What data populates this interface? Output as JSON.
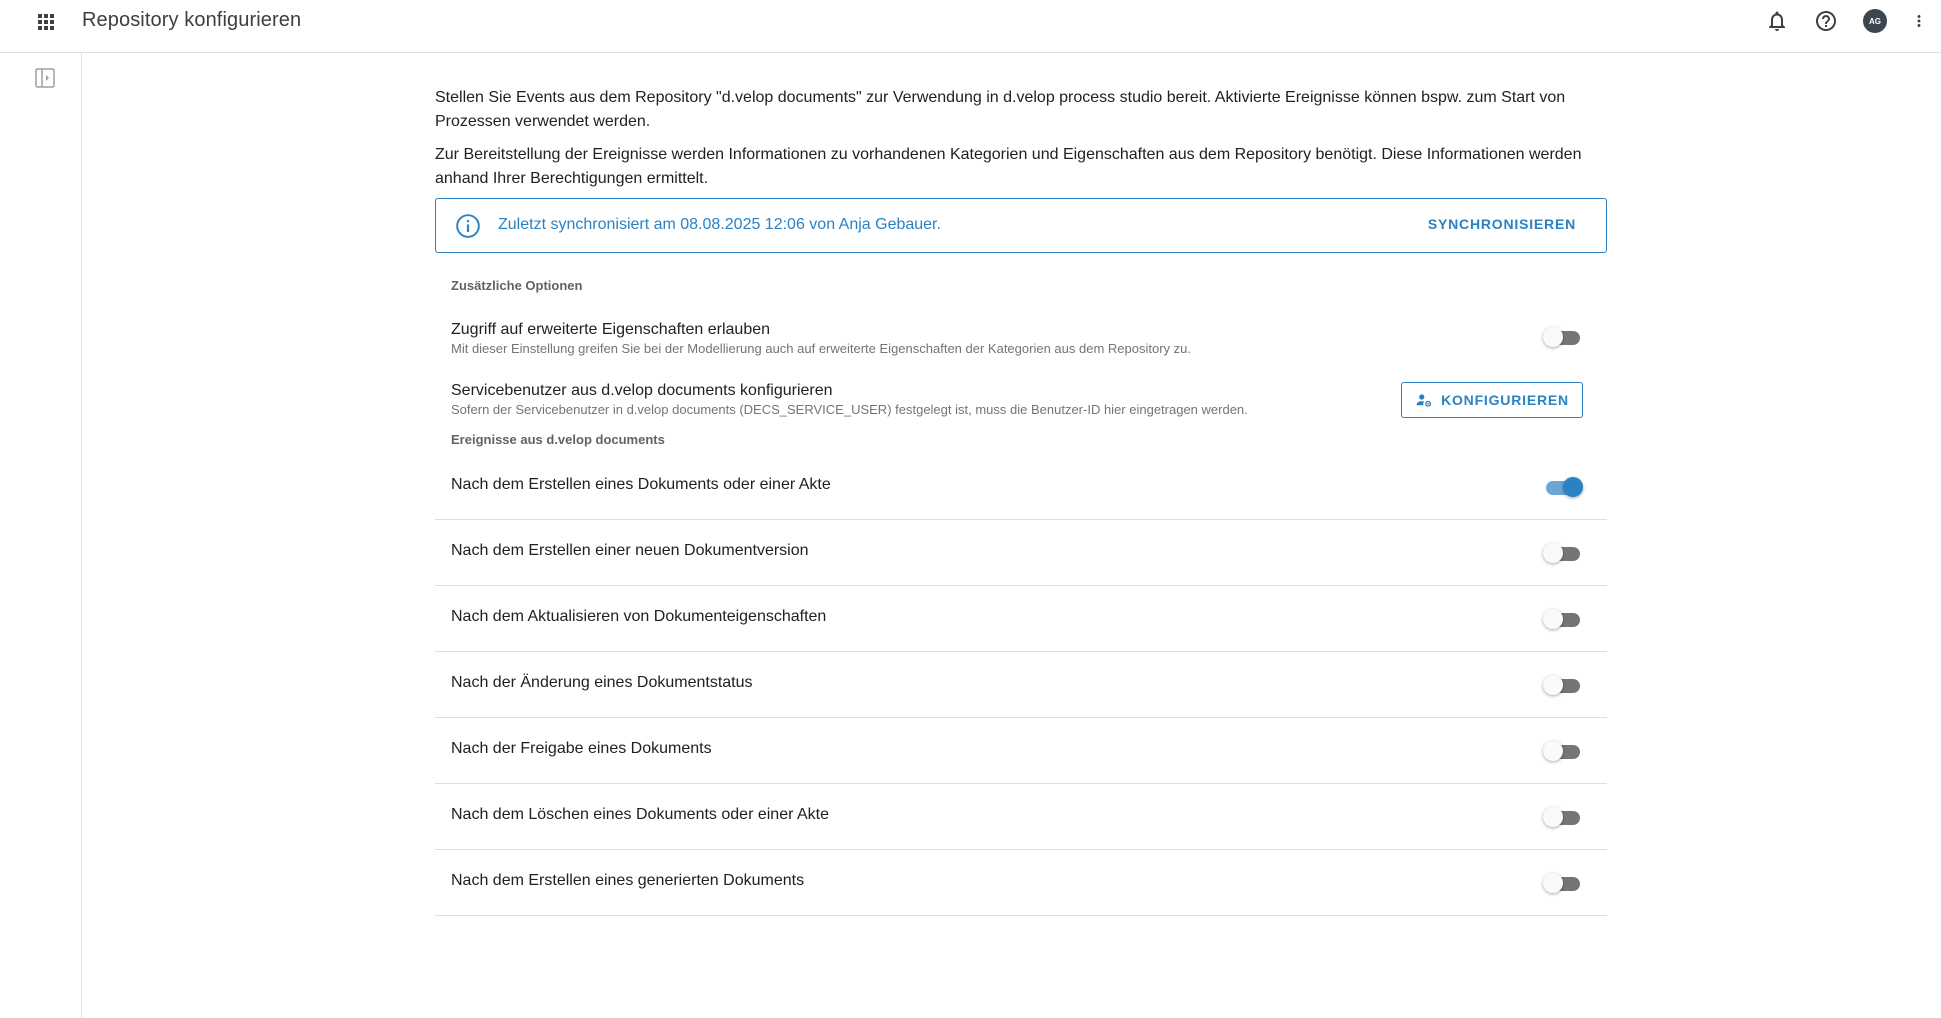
{
  "header": {
    "title": "Repository konfigurieren",
    "avatar_initials": "AG",
    "icons": [
      "apps-grid-icon",
      "bell-icon",
      "help-icon",
      "more-vert-icon"
    ]
  },
  "sidebar": {
    "toggle_icon": "sidebar-toggle-icon"
  },
  "intro": {
    "paragraph1": "Stellen Sie Events aus dem Repository \"d.velop documents\" zur Verwendung in d.velop process studio bereit. Aktivierte Ereignisse können bspw. zum Start von Prozessen verwendet werden.",
    "paragraph2": "Zur Bereitstellung der Ereignisse werden Informationen zu vorhandenen Kategorien und Eigenschaften aus dem Repository benötigt. Diese Informationen werden anhand Ihrer Berechtigungen ermittelt."
  },
  "sync_box": {
    "text": "Zuletzt synchronisiert am 08.08.2025 12:06 von Anja Gebauer.",
    "button_label": "SYNCHRONISIEREN",
    "icon": "info-icon"
  },
  "options": {
    "section_label": "Zusätzliche Optionen",
    "extended_properties": {
      "title": "Zugriff auf erweiterte Eigenschaften erlauben",
      "description": "Mit dieser Einstellung greifen Sie bei der Modellierung auch auf erweiterte Eigenschaften der Kategorien aus dem Repository zu.",
      "enabled": false
    },
    "service_user": {
      "title": "Servicebenutzer aus d.velop documents konfigurieren",
      "description": "Sofern der Servicebenutzer in d.velop documents (DECS_SERVICE_USER) festgelegt ist, muss die Benutzer-ID hier eingetragen werden.",
      "button_label": "KONFIGURIEREN",
      "button_icon": "user-settings-icon"
    }
  },
  "events": {
    "section_label": "Ereignisse aus d.velop documents",
    "items": [
      {
        "label": "Nach dem Erstellen eines Dokuments oder einer Akte",
        "enabled": true
      },
      {
        "label": "Nach dem Erstellen einer neuen Dokumentversion",
        "enabled": false
      },
      {
        "label": "Nach dem Aktualisieren von Dokumenteigenschaften",
        "enabled": false
      },
      {
        "label": "Nach der Änderung eines Dokumentstatus",
        "enabled": false
      },
      {
        "label": "Nach der Freigabe eines Dokuments",
        "enabled": false
      },
      {
        "label": "Nach dem Löschen eines Dokuments oder einer Akte",
        "enabled": false
      },
      {
        "label": "Nach dem Erstellen eines generierten Dokuments",
        "enabled": false
      }
    ]
  },
  "colors": {
    "accent": "#2a82c3",
    "toggle_on_track": "#6aa6d6",
    "toggle_off_track": "#757575",
    "divider": "#e0e0e0"
  }
}
